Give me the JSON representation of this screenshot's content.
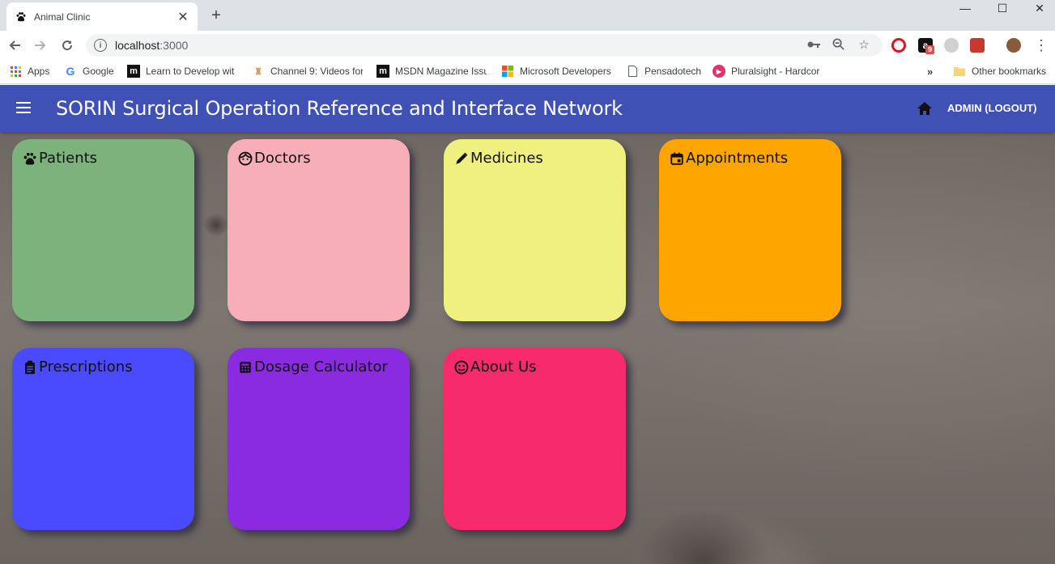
{
  "browser": {
    "tab_title": "Animal Clinic",
    "url_host": "localhost",
    "url_port": ":3000",
    "extension_badge": "9"
  },
  "bookmarks": [
    {
      "label": "Apps",
      "icon": "apps-grid-icon"
    },
    {
      "label": "Google",
      "icon": "google-icon"
    },
    {
      "label": "Learn to Develop wit",
      "icon": "m-icon"
    },
    {
      "label": "Channel 9: Videos for",
      "icon": "channel9-icon"
    },
    {
      "label": "MSDN Magazine Issu",
      "icon": "m-icon"
    },
    {
      "label": "Microsoft Developers",
      "icon": "microsoft-icon"
    },
    {
      "label": "Pensadotech",
      "icon": "page-icon"
    },
    {
      "label": "Pluralsight - Hardcor",
      "icon": "pluralsight-icon"
    }
  ],
  "bookmarks_other": "Other bookmarks",
  "app": {
    "title": "SORIN Surgical Operation Reference and Interface Network",
    "logout_label": "ADMIN (LOGOUT)",
    "primary_color": "#3f51b5"
  },
  "cards": [
    {
      "label": "Patients",
      "icon": "paw-icon",
      "color": "#7cb37c"
    },
    {
      "label": "Doctors",
      "icon": "face-icon",
      "color": "#f8aeb8"
    },
    {
      "label": "Medicines",
      "icon": "pen-icon",
      "color": "#f0f080"
    },
    {
      "label": "Appointments",
      "icon": "calendar-icon",
      "color": "#ffa500"
    },
    {
      "label": "Prescriptions",
      "icon": "clipboard-icon",
      "color": "#4a4aff"
    },
    {
      "label": "Dosage Calculator",
      "icon": "calculator-icon",
      "color": "#8a2be2"
    },
    {
      "label": "About Us",
      "icon": "smile-icon",
      "color": "#f72a6e"
    }
  ]
}
